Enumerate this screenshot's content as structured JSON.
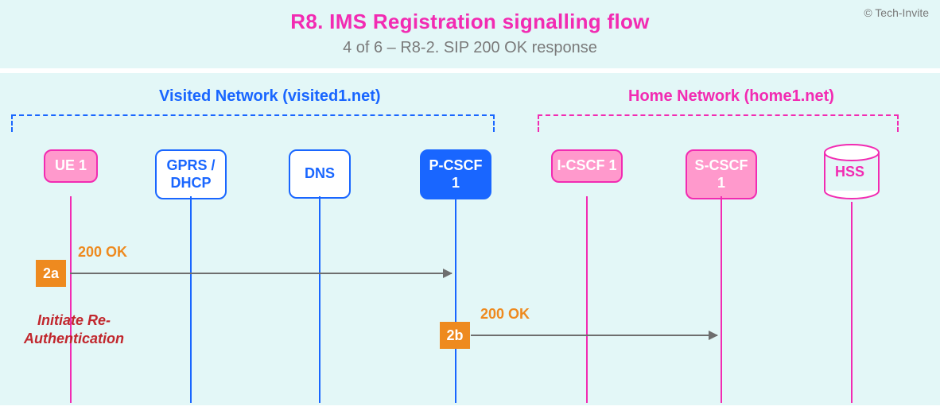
{
  "header": {
    "copyright": "© Tech-Invite",
    "title": "R8. IMS Registration signalling flow",
    "subtitle": "4 of 6 – R8-2. SIP 200 OK response"
  },
  "networks": {
    "visited": "Visited Network (visited1.net)",
    "home": "Home Network (home1.net)"
  },
  "nodes": {
    "ue": "UE 1",
    "gprs": "GPRS / DHCP",
    "dns": "DNS",
    "pcscf": "P-CSCF 1",
    "icscf": "I-CSCF 1",
    "scscf": "S-CSCF 1",
    "hss": "HSS"
  },
  "steps": {
    "s2a": {
      "id": "2a",
      "msg": "200 OK"
    },
    "s2b": {
      "id": "2b",
      "msg": "200 OK"
    }
  },
  "note": {
    "line1": "Initiate Re-",
    "line2": "Authentication"
  }
}
